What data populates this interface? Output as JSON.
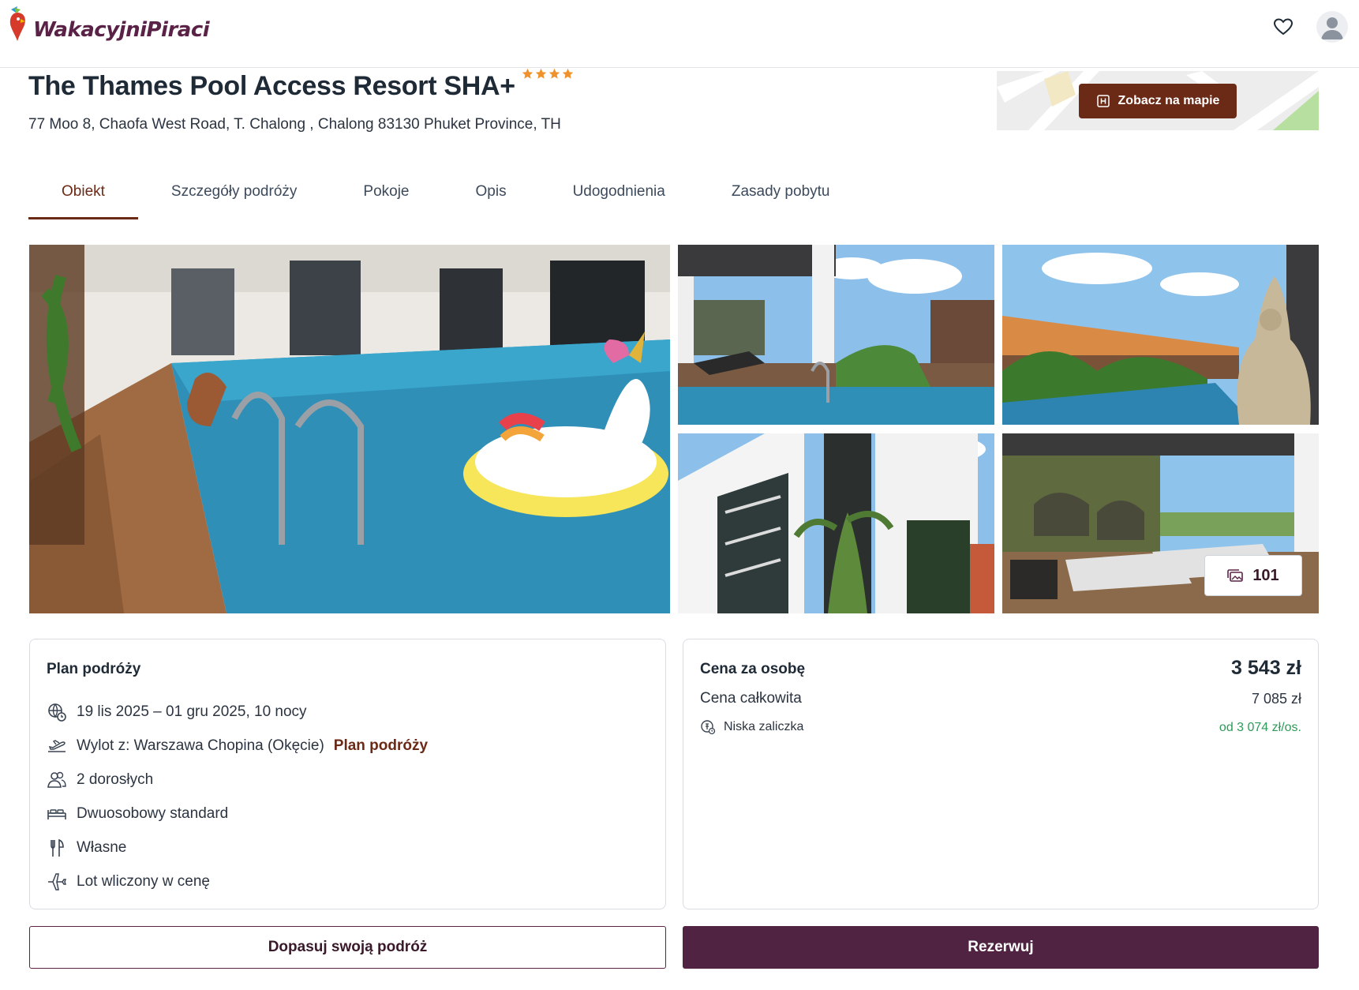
{
  "header": {
    "logo_text": "WakacyjniPiraci",
    "brand_color": "#5b2247",
    "favorites_icon": "heart-icon",
    "account_icon": "user-avatar-icon"
  },
  "hotel": {
    "name": "The Thames Pool Access Resort SHA+",
    "stars": 4,
    "address": "77 Moo 8, Chaofa West Road, T. Chalong , Chalong 83130 Phuket Province, TH"
  },
  "map": {
    "button_label": "Zobacz na mapie",
    "button_icon": "hotel-pin-icon"
  },
  "tabs": [
    {
      "label": "Obiekt",
      "active": true
    },
    {
      "label": "Szczegóły podróży",
      "active": false
    },
    {
      "label": "Pokoje",
      "active": false
    },
    {
      "label": "Opis",
      "active": false
    },
    {
      "label": "Udogodnienia",
      "active": false
    },
    {
      "label": "Zasady pobytu",
      "active": false
    }
  ],
  "gallery": {
    "photo_count": "101",
    "photos_icon": "images-icon"
  },
  "plan": {
    "title": "Plan podróży",
    "dates": "19 lis 2025 – 01 gru 2025, 10 nocy",
    "departure": "Wylot z: Warszawa Chopina (Okęcie)",
    "departure_link": "Plan podróży",
    "travelers": "2 dorosłych",
    "room": "Dwuosobowy standard",
    "board": "Własne",
    "flight": "Lot wliczony w cenę"
  },
  "price": {
    "per_person_label": "Cena za osobę",
    "per_person_value": "3 543 zł",
    "total_label": "Cena całkowita",
    "total_value": "7 085 zł",
    "deposit_label": "Niska zaliczka",
    "deposit_value": "od 3 074 zł/os.",
    "deposit_color": "#2e9a5a"
  },
  "actions": {
    "customize_label": "Dopasuj swoją podróż",
    "book_label": "Rezerwuj",
    "accent_color": "#6b2a16"
  }
}
